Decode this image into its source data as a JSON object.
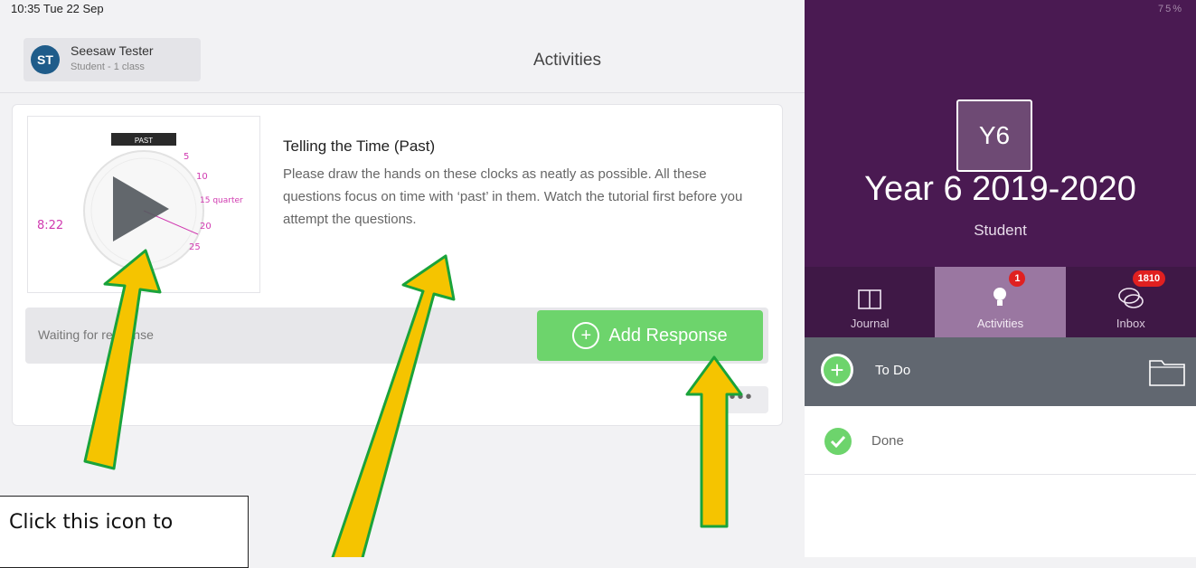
{
  "status_bar": {
    "time": "10:35  Tue 22 Sep",
    "right": "75%"
  },
  "user": {
    "initials": "ST",
    "name": "Seesaw Tester",
    "role": "Student - 1 class"
  },
  "page": {
    "title": "Activities"
  },
  "activity": {
    "title": "Telling the Time (Past)",
    "description": "Please draw the hands on these clocks as neatly as possible. All these questions focus on time with ‘past’ in them. Watch the tutorial first before you attempt the questions.",
    "thumbnail": {
      "label": "PAST",
      "annotations": [
        "5",
        "10",
        "15 quarter",
        "20",
        "25",
        "8:22"
      ]
    },
    "waiting_text": "Waiting for response",
    "add_response_label": "Add Response",
    "more_label": "•••"
  },
  "class_panel": {
    "badge": "Y6",
    "name": "Year 6 2019-2020",
    "role": "Student",
    "nav": [
      {
        "label": "Journal",
        "badge": ""
      },
      {
        "label": "Activities",
        "badge": "1"
      },
      {
        "label": "Inbox",
        "badge": "1810"
      }
    ],
    "todo_label": "To Do",
    "done_label": "Done"
  },
  "annotation": {
    "callout_text": "Click this icon to"
  },
  "colors": {
    "purple_header": "#4a1a52",
    "nav_active": "#9a77a1",
    "green": "#6dd46c",
    "arrow_fill": "#f5c400",
    "arrow_stroke": "#1aa33a",
    "badge_red": "#e02020"
  }
}
